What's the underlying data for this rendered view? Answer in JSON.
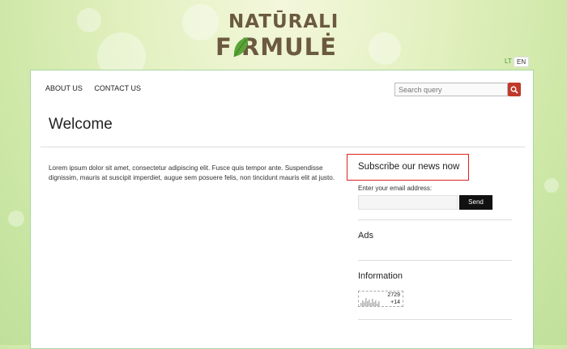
{
  "brand": {
    "line1": "NATŪRALI",
    "line2": "F  RMULĖ"
  },
  "languages": [
    "LT",
    "EN"
  ],
  "nav": {
    "items": [
      "ABOUT US",
      "CONTACT US"
    ]
  },
  "search": {
    "placeholder": "Search query"
  },
  "page": {
    "title": "Welcome",
    "body": "Lorem ipsum dolor sit amet, consectetur adipiscing elit. Fusce quis tempor ante. Suspendisse dignissim, mauris at suscipit imperdiet, augue sem posuere felis, non tincidunt mauris elit at justo."
  },
  "sidebar": {
    "subscribe_title": "Subscribe our news now",
    "email_label": "Enter your email address:",
    "send_label": "Send",
    "ads_title": "Ads",
    "info_title": "Information",
    "counter": {
      "total": "2729",
      "today": "+14"
    }
  },
  "colors": {
    "accent": "#c0392b",
    "highlight": "#e02020",
    "brand": "#6b5a3f",
    "leaf": "#5aa43a"
  }
}
